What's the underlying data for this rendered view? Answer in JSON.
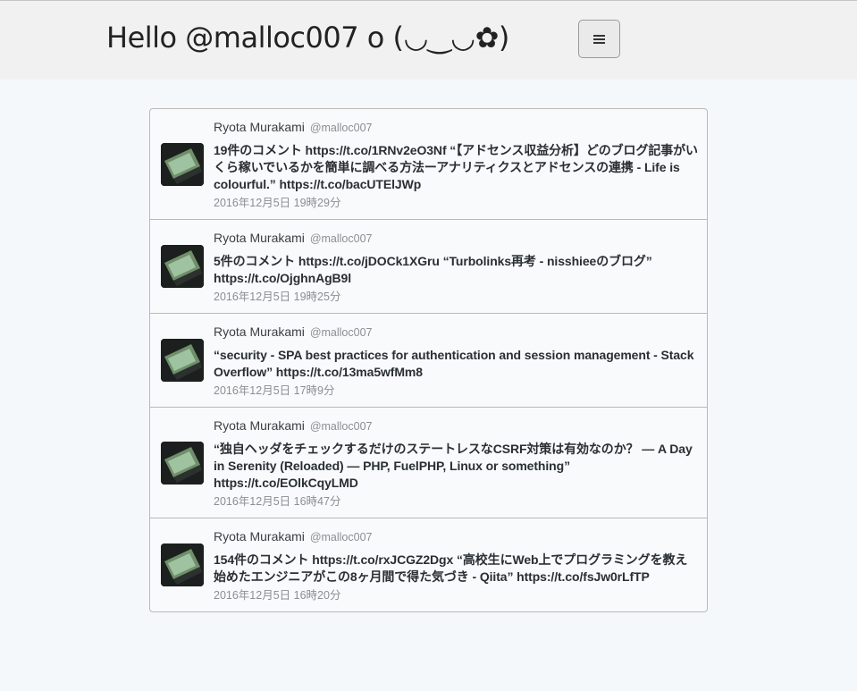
{
  "header": {
    "title": "Hello @malloc007 o (◡‿◡✿)",
    "menu_icon": "hamburger-icon"
  },
  "tweets": [
    {
      "name": "Ryota Murakami",
      "handle": "@malloc007",
      "text": "19件のコメント https://t.co/1RNv2eO3Nf “【アドセンス収益分析】どのブログ記事がいくら稼いでいるかを簡単に調べる方法ーアナリティクスとアドセンスの連携 - Life is colourful.” https://t.co/bacUTElJWp",
      "time": "2016年12月5日 19時29分"
    },
    {
      "name": "Ryota Murakami",
      "handle": "@malloc007",
      "text": "5件のコメント https://t.co/jDOCk1XGru “Turbolinks再考 - nisshieeのブログ” https://t.co/OjghnAgB9l",
      "time": "2016年12月5日 19時25分"
    },
    {
      "name": "Ryota Murakami",
      "handle": "@malloc007",
      "text": "“security - SPA best practices for authentication and session management - Stack Overflow” https://t.co/13ma5wfMm8",
      "time": "2016年12月5日 17時9分"
    },
    {
      "name": "Ryota Murakami",
      "handle": "@malloc007",
      "text": "“独自ヘッダをチェックするだけのステートレスなCSRF対策は有効なのか？ — A Day in Serenity (Reloaded) — PHP, FuelPHP, Linux or something” https://t.co/EOlkCqyLMD",
      "time": "2016年12月5日 16時47分"
    },
    {
      "name": "Ryota Murakami",
      "handle": "@malloc007",
      "text": "154件のコメント https://t.co/rxJCGZ2Dgx “高校生にWeb上でプログラミングを教え始めたエンジニアがこの8ヶ月間で得た気づき - Qiita” https://t.co/fsJw0rLfTP",
      "time": "2016年12月5日 16時20分"
    }
  ]
}
